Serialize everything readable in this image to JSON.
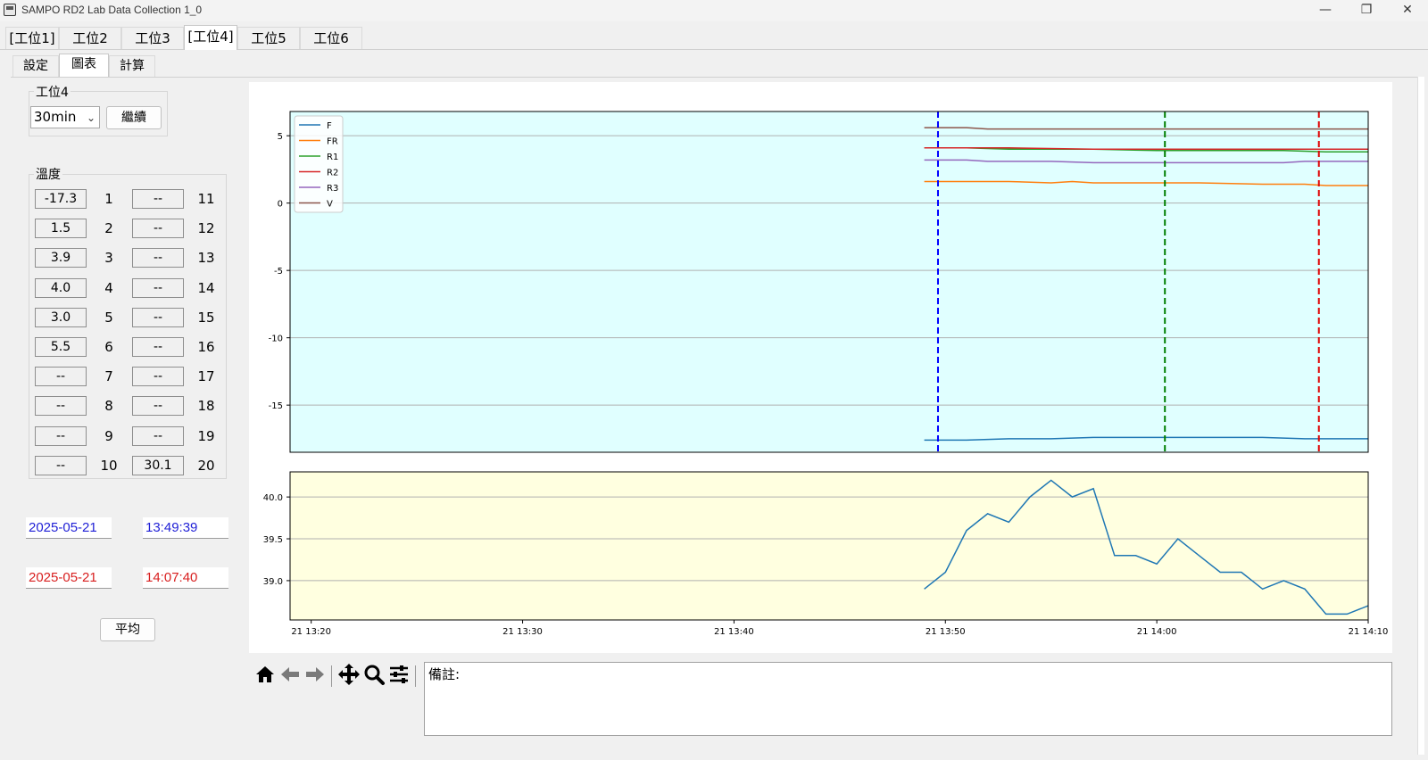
{
  "window": {
    "title": "SAMPO RD2 Lab Data Collection 1_0",
    "minimize": "—",
    "restore": "❐",
    "close": "✕"
  },
  "station_tabs": [
    "[工位1]",
    "工位2",
    "工位3",
    "[工位4]",
    "工位5",
    "工位6"
  ],
  "active_station_tab": 3,
  "sub_tabs": [
    "設定",
    "圖表",
    "計算"
  ],
  "active_sub_tab": 1,
  "controls": {
    "group_title": "工位4",
    "interval_value": "30min",
    "continue_label": "繼續"
  },
  "temperature": {
    "group_title": "溫度",
    "channels_left": [
      {
        "num": "1",
        "value": "-17.3"
      },
      {
        "num": "2",
        "value": "1.5"
      },
      {
        "num": "3",
        "value": "3.9"
      },
      {
        "num": "4",
        "value": "4.0"
      },
      {
        "num": "5",
        "value": "3.0"
      },
      {
        "num": "6",
        "value": "5.5"
      },
      {
        "num": "7",
        "value": "--"
      },
      {
        "num": "8",
        "value": "--"
      },
      {
        "num": "9",
        "value": "--"
      },
      {
        "num": "10",
        "value": "--"
      }
    ],
    "channels_right": [
      {
        "num": "11",
        "value": "--"
      },
      {
        "num": "12",
        "value": "--"
      },
      {
        "num": "13",
        "value": "--"
      },
      {
        "num": "14",
        "value": "--"
      },
      {
        "num": "15",
        "value": "--"
      },
      {
        "num": "16",
        "value": "--"
      },
      {
        "num": "17",
        "value": "--"
      },
      {
        "num": "18",
        "value": "--"
      },
      {
        "num": "19",
        "value": "--"
      },
      {
        "num": "20",
        "value": "30.1"
      }
    ]
  },
  "range": {
    "start_date": "2025-05-21",
    "start_time": "13:49:39",
    "end_date": "2025-05-21",
    "end_time": "14:07:40",
    "start_color": "#1f1fd6",
    "end_color": "#d81f1f",
    "average_label": "平均"
  },
  "toolbar_icons": [
    "home-icon",
    "back-arrow-icon",
    "forward-arrow-icon",
    "pan-icon",
    "zoom-icon",
    "configure-icon"
  ],
  "notes": {
    "label": "備註:"
  },
  "chart_data": [
    {
      "type": "line",
      "background": "#e0ffff",
      "ylim": [
        -18.5,
        6.8
      ],
      "yticks": [
        5,
        0,
        -5,
        -10,
        -15
      ],
      "grid": "horizontal",
      "legend_position": "top-left",
      "xtime_range": [
        "13:19",
        "14:10"
      ],
      "series": [
        {
          "name": "F",
          "color": "#1f77b4",
          "x": [
            "13:49",
            "13:51",
            "13:53",
            "13:55",
            "13:57",
            "14:00",
            "14:03",
            "14:05",
            "14:07",
            "14:08",
            "14:10"
          ],
          "y": [
            -17.6,
            -17.6,
            -17.5,
            -17.5,
            -17.4,
            -17.4,
            -17.4,
            -17.4,
            -17.5,
            -17.5,
            -17.5
          ]
        },
        {
          "name": "FR",
          "color": "#ff7f0e",
          "x": [
            "13:49",
            "13:53",
            "13:55",
            "13:56",
            "13:57",
            "14:00",
            "14:02",
            "14:05",
            "14:07",
            "14:08",
            "14:10"
          ],
          "y": [
            1.6,
            1.6,
            1.5,
            1.6,
            1.5,
            1.5,
            1.5,
            1.4,
            1.4,
            1.3,
            1.3
          ]
        },
        {
          "name": "R1",
          "color": "#2ca02c",
          "x": [
            "13:49",
            "13:51",
            "13:53",
            "13:55",
            "13:57",
            "14:00",
            "14:03",
            "14:06",
            "14:08",
            "14:10"
          ],
          "y": [
            4.1,
            4.1,
            4.0,
            4.0,
            4.0,
            3.9,
            3.9,
            3.9,
            3.8,
            3.8
          ]
        },
        {
          "name": "R2",
          "color": "#d62728",
          "x": [
            "13:49",
            "13:53",
            "13:57",
            "14:00",
            "14:04",
            "14:07",
            "14:10"
          ],
          "y": [
            4.1,
            4.1,
            4.0,
            4.0,
            4.0,
            4.0,
            4.0
          ]
        },
        {
          "name": "R3",
          "color": "#9467bd",
          "x": [
            "13:49",
            "13:51",
            "13:52",
            "13:55",
            "13:57",
            "14:00",
            "14:03",
            "14:06",
            "14:07",
            "14:10"
          ],
          "y": [
            3.2,
            3.2,
            3.1,
            3.1,
            3.0,
            3.0,
            3.0,
            3.0,
            3.1,
            3.1
          ]
        },
        {
          "name": "V",
          "color": "#8c564b",
          "x": [
            "13:49",
            "13:51",
            "13:52",
            "13:55",
            "13:57",
            "14:00",
            "14:03",
            "14:05",
            "14:07",
            "14:10"
          ],
          "y": [
            5.6,
            5.6,
            5.5,
            5.5,
            5.5,
            5.5,
            5.5,
            5.5,
            5.5,
            5.5
          ]
        }
      ],
      "markers": [
        {
          "x": "13:49:39",
          "color": "#0000ff"
        },
        {
          "x": "14:00:23",
          "color": "#007f00"
        },
        {
          "x": "14:07:40",
          "color": "#e00000"
        }
      ]
    },
    {
      "type": "line",
      "background": "#ffffe0",
      "ylim": [
        38.53,
        40.3
      ],
      "yticks": [
        40.0,
        39.5,
        39.0
      ],
      "ytick_labels": [
        "40.0",
        "39.5",
        "39.0"
      ],
      "grid": "horizontal",
      "xticks": [
        "13:20",
        "13:30",
        "13:40",
        "13:50",
        "14:00",
        "14:10"
      ],
      "xtick_labels": [
        "21 13:20",
        "21 13:30",
        "21 13:40",
        "21 13:50",
        "21 14:00",
        "21 14:10"
      ],
      "series": [
        {
          "color": "#1f77b4",
          "x": [
            "13:49",
            "13:50",
            "13:51",
            "13:52",
            "13:53",
            "13:54",
            "13:55",
            "13:56",
            "13:57",
            "13:58",
            "13:59",
            "14:00",
            "14:01",
            "14:02",
            "14:03",
            "14:04",
            "14:05",
            "14:06",
            "14:07",
            "14:08",
            "14:09",
            "14:10"
          ],
          "y": [
            38.9,
            39.1,
            39.6,
            39.8,
            39.7,
            40.0,
            40.2,
            40.0,
            40.1,
            39.3,
            39.3,
            39.2,
            39.5,
            39.3,
            39.1,
            39.1,
            38.9,
            39.0,
            38.9,
            38.6,
            38.6,
            38.7
          ]
        }
      ]
    }
  ]
}
